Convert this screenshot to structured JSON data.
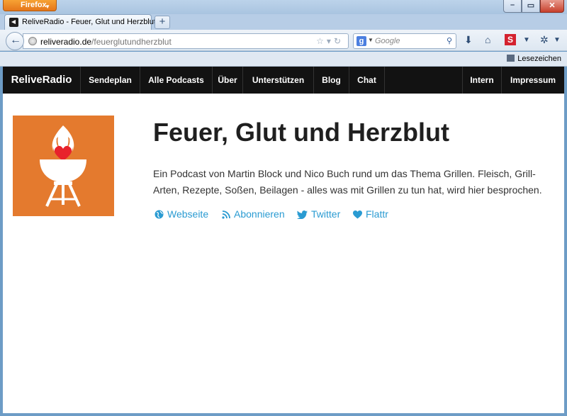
{
  "browser": {
    "app_button": "Firefox",
    "tab_title": "ReliveRadio - Feuer, Glut und Herzblut",
    "url_host": "reliveradio.de",
    "url_path": "/feuerglutundherzblut",
    "search_engine": "Google",
    "search_placeholder": "Google",
    "bookmarks_label": "Lesezeichen"
  },
  "site_nav": {
    "brand": "ReliveRadio",
    "items": [
      "Sendeplan",
      "Alle Podcasts",
      "Über",
      "Unterstützen",
      "Blog",
      "Chat"
    ],
    "right_items": [
      "Intern",
      "Impressum"
    ]
  },
  "podcast": {
    "title": "Feuer, Glut und Herzblut",
    "description": "Ein Podcast von Martin Block und Nico Buch rund um das Thema Grillen. Fleisch, Grill-Arten, Rezepte, Soßen, Beilagen - alles was mit Grillen zu tun hat, wird hier besprochen.",
    "links": [
      {
        "label": "Webseite",
        "icon": "globe-icon"
      },
      {
        "label": "Abonnieren",
        "icon": "rss-icon"
      },
      {
        "label": "Twitter",
        "icon": "twitter-icon"
      },
      {
        "label": "Flattr",
        "icon": "heart-icon"
      }
    ],
    "logo_color": "#e47a2e",
    "link_color": "#2a9bd2"
  }
}
